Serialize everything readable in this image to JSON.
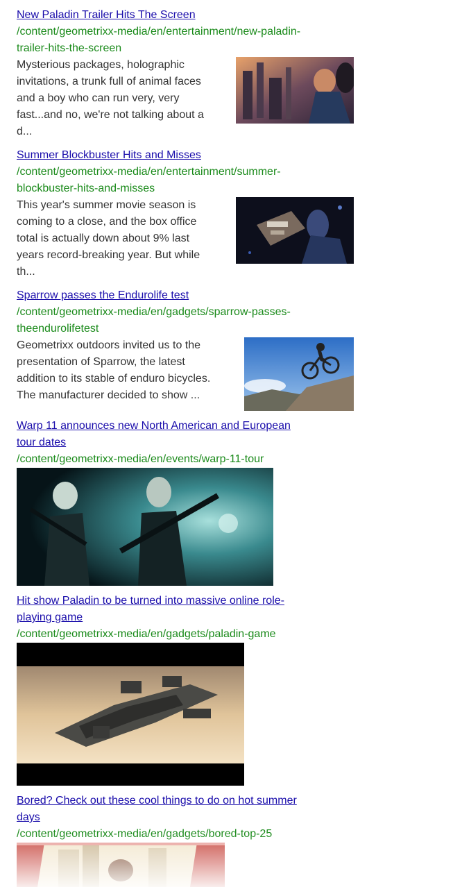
{
  "results": [
    {
      "title": "New Paladin Trailer Hits The Screen",
      "path_line1": "/content/geometrixx-media/en/entertainment/new-paladin-",
      "path_line2": "trailer-hits-the-screen",
      "desc_lines": [
        "Mysterious packages, holographic",
        "invitations, a trunk full of animal faces",
        "and a boy who can run very, very",
        "fast...and no, we're not talking about a",
        "d..."
      ]
    },
    {
      "title": "Summer Blockbuster Hits and Misses",
      "path_line1": "/content/geometrixx-media/en/entertainment/summer-",
      "path_line2": "blockbuster-hits-and-misses",
      "desc_lines": [
        "This year's summer movie season is",
        "coming to a close, and the box office",
        "total is actually down about 9% last",
        "years record-breaking year. But while",
        "th..."
      ]
    },
    {
      "title": "Sparrow passes the Endurolife test",
      "path_line1": "/content/geometrixx-media/en/gadgets/sparrow-passes-",
      "path_line2": "theendurolifetest",
      "desc_lines": [
        "Geometrixx outdoors invited us to the",
        "presentation of Sparrow, the latest",
        "addition to its stable of enduro bicycles.",
        "The manufacturer decided to show ..."
      ]
    },
    {
      "title_line1": "Warp 11 announces new North American and European",
      "title_line2": "tour dates",
      "path": "/content/geometrixx-media/en/events/warp-11-tour"
    },
    {
      "title_line1": "Hit show Paladin to be turned into massive online role-",
      "title_line2": "playing game",
      "path": "/content/geometrixx-media/en/gadgets/paladin-game"
    },
    {
      "title_line1": "Bored? Check out these cool things to do on hot summer",
      "title_line2": "days",
      "path": "/content/geometrixx-media/en/gadgets/bored-top-25"
    }
  ],
  "colors": {
    "link": "#1a0dab",
    "path": "#1a8a1a",
    "text": "#333333"
  },
  "images": [
    "paladin-trailer-thumbnail",
    "blockbuster-thumbnail",
    "sparrow-bike-thumbnail",
    "warp-11-concert-image",
    "paladin-game-spaceship-image",
    "bored-summer-illustration"
  ]
}
